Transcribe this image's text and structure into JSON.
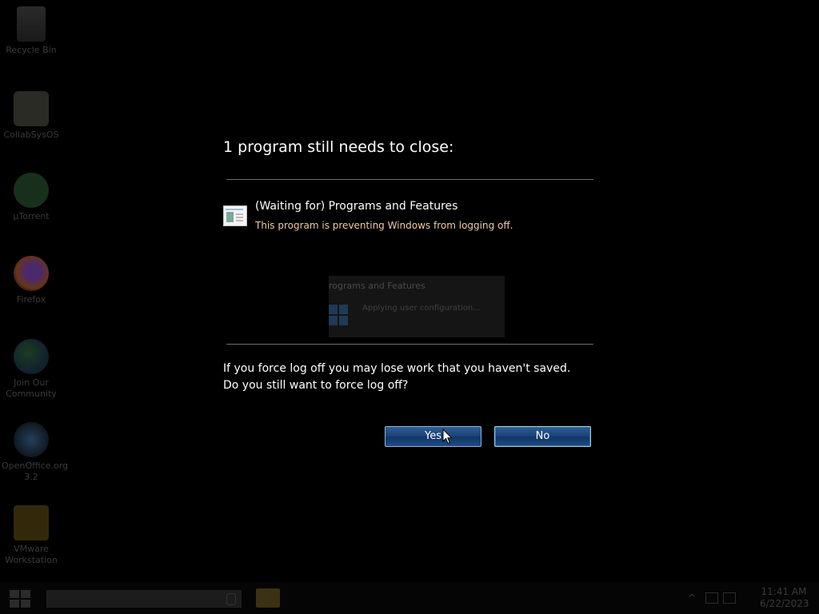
{
  "desktop": {
    "icons": [
      {
        "label": "Recycle Bin",
        "icon": "recycle-bin-icon"
      },
      {
        "label": "CollabSysOS",
        "icon": "folder-icon"
      },
      {
        "label": "µTorrent",
        "icon": "utorrent-icon"
      },
      {
        "label": "Firefox",
        "icon": "firefox-icon"
      },
      {
        "label": "Join Our Community",
        "icon": "globe-icon"
      },
      {
        "label": "OpenOffice.org 3.2",
        "icon": "openoffice-icon"
      },
      {
        "label": "VMware Workstation",
        "icon": "vmware-icon"
      }
    ]
  },
  "dialog": {
    "title": "1 program still needs to close:",
    "program": {
      "name": "(Waiting for) Programs and Features",
      "reason": "This program is preventing Windows from logging off."
    },
    "preview": {
      "title": "rograms and Features",
      "text": "Applying user configuration..."
    },
    "warning_line1": "If you force log off you may lose work that you haven't saved.",
    "warning_line2": "Do you still want to force log off?",
    "yes_label": "Yes",
    "no_label": "No",
    "reason_color": "#f1c9a4"
  },
  "taskbar": {
    "clock_time": "11:41 AM",
    "clock_date": "6/22/2023"
  }
}
